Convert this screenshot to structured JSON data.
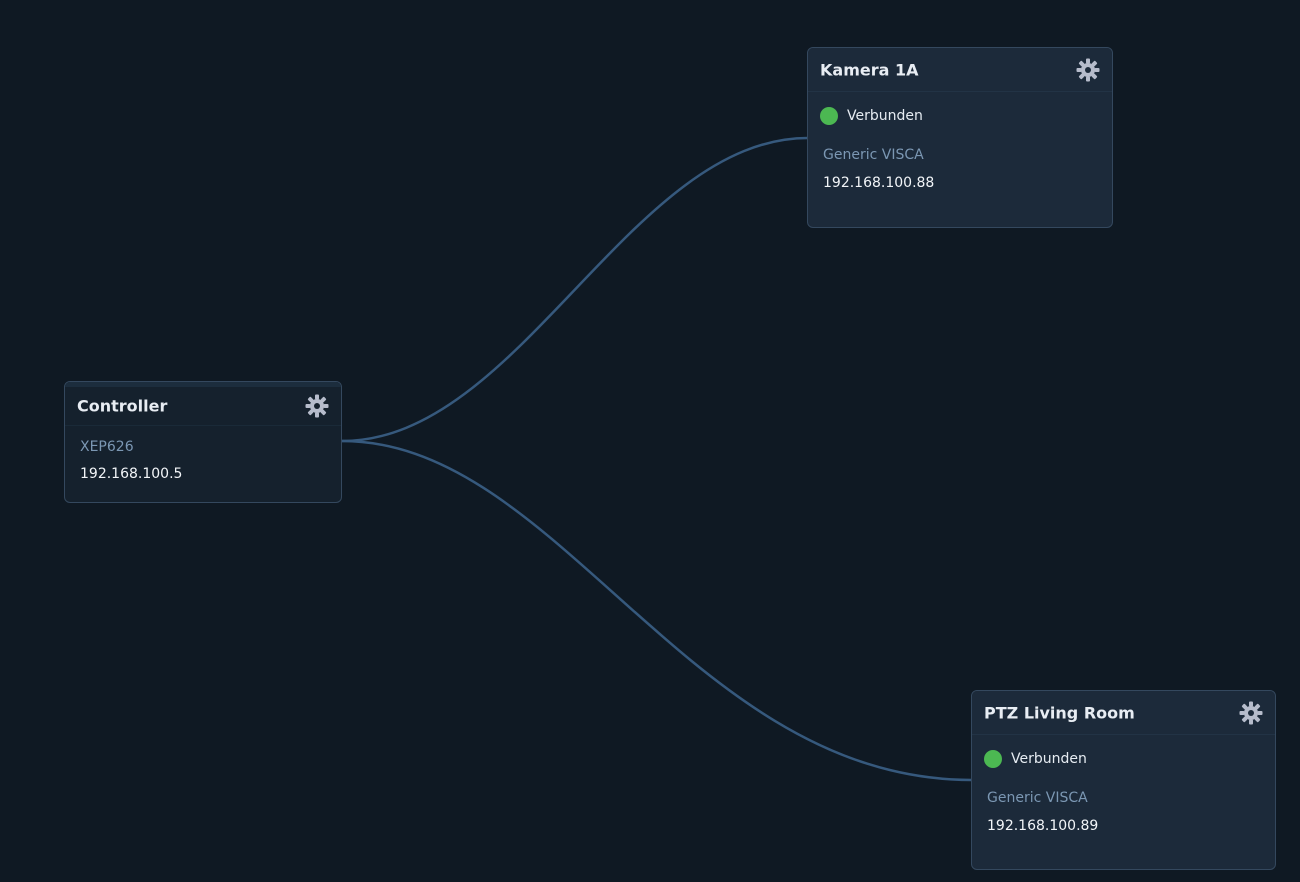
{
  "colors": {
    "background": "#0f1923",
    "edge": "#36597d",
    "status_connected": "#4cb852",
    "card_border": "#34485e"
  },
  "nodes": {
    "controller": {
      "title": "Controller",
      "model": "XEP626",
      "ip": "192.168.100.5",
      "icon": "gear-icon"
    },
    "camera1": {
      "title": "Kamera 1A",
      "status": "Verbunden",
      "model": "Generic VISCA",
      "ip": "192.168.100.88",
      "icon": "gear-icon"
    },
    "camera2": {
      "title": "PTZ Living Room",
      "status": "Verbunden",
      "model": "Generic VISCA",
      "ip": "192.168.100.89",
      "icon": "gear-icon"
    }
  }
}
